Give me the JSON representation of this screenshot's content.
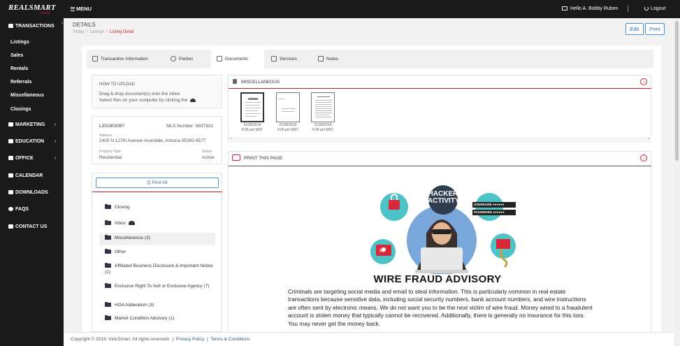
{
  "topbar": {
    "logo": "REALSMART",
    "logo_sub": "AGENT",
    "menu_label": "MENU",
    "greeting": "Hello A. Bobby Ruben",
    "logout_label": "Logout"
  },
  "sidebar": {
    "transactions": "TRANSACTIONS",
    "sub_items": [
      "Listings",
      "Sales",
      "Rentals",
      "Referrals",
      "Miscellaneous",
      "Closings"
    ],
    "marketing": "MARKETING",
    "education": "EDUCATION",
    "office": "OFFICE",
    "calendar": "CALENDAR",
    "downloads": "DOWNLOADS",
    "faqs": "FAQS",
    "contact": "CONTACT US"
  },
  "header": {
    "title": "DETAILS",
    "breadcrumb": [
      "Today",
      "Listings",
      "Listing Detail"
    ],
    "edit_label": "Edit",
    "print_label": "Print"
  },
  "tabs": [
    "Transaction Information",
    "Parties",
    "Documents",
    "Services",
    "Notes"
  ],
  "upload": {
    "title": "HOW TO UPLOAD",
    "line1": "Drag & drop document(s) onto the inbox",
    "line2": "Select files on your computer by clicking the"
  },
  "listing": {
    "id": "L201902097",
    "mls_label": "MLS Number:",
    "mls_number": "5837831",
    "address_label": "Address",
    "address": "2405 N 127th Avenue Avondale, Arizona 85392-6577",
    "type_label": "Property Type",
    "type": "Residential",
    "status_label": "Status",
    "status": "Active"
  },
  "folders": {
    "print_all": "Print All",
    "items": [
      "Closing",
      "Inbox",
      "Miscellaneous (3)",
      "Other",
      "Affiliated Business Disclosure & Important",
      "Notice (1)",
      "Exclusive Right To Sell or Exclusive Agency",
      "(7)",
      "HOA Addendum (3)",
      "Market Condition Advisory (1)"
    ]
  },
  "misc_panel": {
    "title": "MISCELLANEOUS",
    "docs": [
      {
        "date": "01/08/2019",
        "time": "5:05 pm MST"
      },
      {
        "date": "01/08/2019",
        "time": "5:05 pm MST"
      },
      {
        "date": "01/08/2019",
        "time": "5:06 pm MST"
      }
    ]
  },
  "print_panel": {
    "title": "PRINT THIS PAGE"
  },
  "advisory": {
    "hacker_line1": "HACKER",
    "hacker_line2": "ACTIVITY",
    "username": "USERNAME",
    "password": "PASSWORD",
    "title": "WIRE FRAUD ADVISORY",
    "body": "Criminals are targeting social media and email to steal information.  This is particularly common in real estate transactions because sensitive data, including social security numbers, bank account numbers, and wire instructions are often sent by electronic means.  We do not want you to be the next victim of wire fraud.  Money wired to a fraudulent account is stolen money that typically cannot be recovered. Additionally, there is generally no insurance for this loss.  You may never get the money back."
  },
  "footer": {
    "copyright": "Copyright © 2019. VirtuSmart. All rights reserved.",
    "privacy": "Privacy Policy",
    "terms": "Terms & Conditions"
  },
  "colors": {
    "accent_red": "#c8202f",
    "sidebar_bg": "#1a1a1a",
    "button_blue": "#4a8fc7"
  }
}
